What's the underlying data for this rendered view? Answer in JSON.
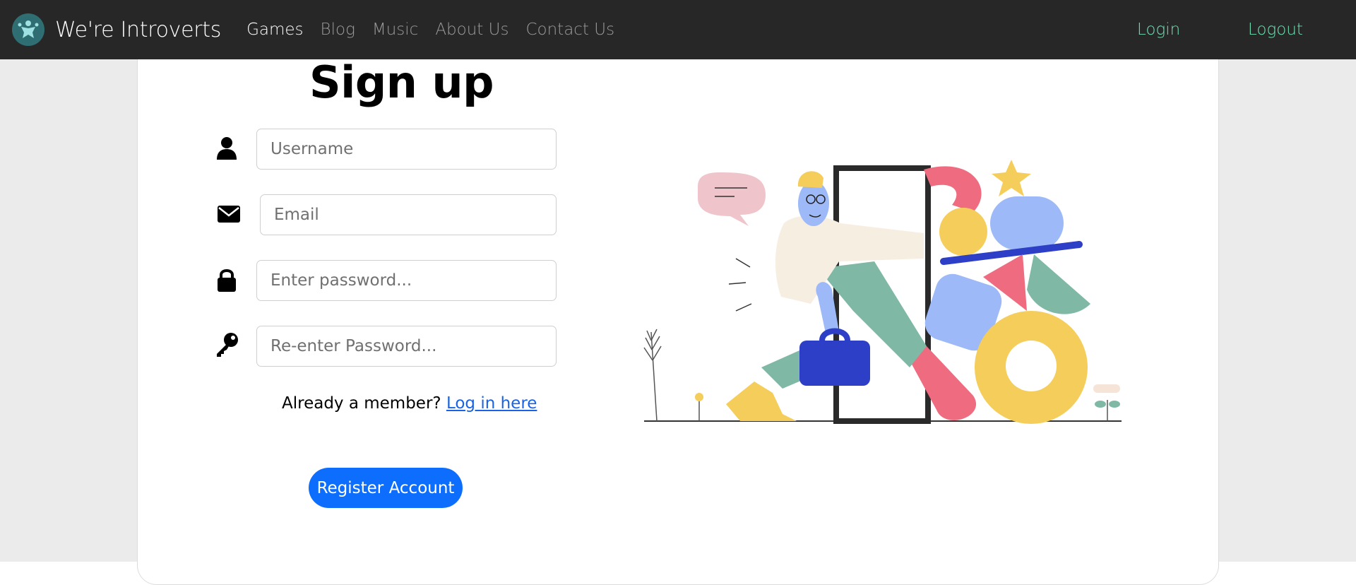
{
  "navbar": {
    "brand": "We're Introverts",
    "links": [
      {
        "label": "Games",
        "active": true
      },
      {
        "label": "Blog",
        "active": false
      },
      {
        "label": "Music",
        "active": false
      },
      {
        "label": "About Us",
        "active": false
      },
      {
        "label": "Contact Us",
        "active": false
      }
    ],
    "login_label": "Login",
    "logout_label": "Logout"
  },
  "form": {
    "title": "Sign up",
    "username_placeholder": "Username",
    "email_placeholder": "Email",
    "password_placeholder": "Enter password...",
    "reenter_placeholder": "Re-enter Password...",
    "member_text": "Already a member?",
    "login_link": "Log in here",
    "register_label": "Register Account"
  },
  "colors": {
    "navbar_bg": "#272727",
    "brand_link": "#6fe0b3",
    "primary_button": "#0d6efd",
    "page_bg": "#ebebeb"
  },
  "icons": [
    "user-icon",
    "envelope-icon",
    "lock-icon",
    "key-icon",
    "brand-logo-icon"
  ]
}
